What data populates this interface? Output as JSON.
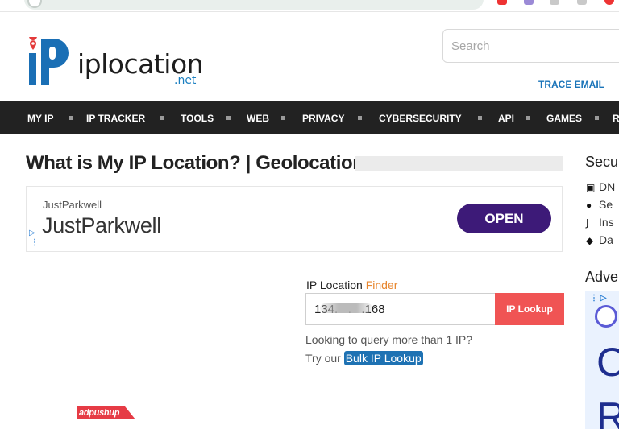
{
  "header": {
    "logo_text": "iplocation",
    "logo_suffix": ".net",
    "search_placeholder": "Search",
    "trace_email": "TRACE EMAIL"
  },
  "nav": {
    "items": [
      "MY IP",
      "IP TRACKER",
      "TOOLS",
      "WEB",
      "PRIVACY",
      "CYBERSECURITY",
      "API",
      "GAMES",
      "R"
    ]
  },
  "main": {
    "title": "What is My IP Location? | Geolocation",
    "ad": {
      "small_label": "JustParkwell",
      "big_label": "JustParkwell",
      "cta": "OPEN"
    },
    "finder": {
      "label_prefix": "IP Location",
      "label_accent": "Finder",
      "ip_value": "134.   .   .168",
      "button": "IP Lookup"
    },
    "query_text": "Looking to query more than 1 IP?",
    "try_text": "Try our",
    "bulk_link": "Bulk IP Lookup",
    "adpushup": "adpushup"
  },
  "sidebar": {
    "heading_security": "Secu",
    "items": [
      "DN",
      "Se",
      "Ins",
      "Da"
    ],
    "heading_ads": "Adve",
    "ad_letters": [
      "C",
      "R"
    ]
  },
  "colors": {
    "nav_bg": "#222222",
    "accent_orange": "#e8862e",
    "lookup_red": "#f05454",
    "link_blue": "#1e72b3",
    "ad_purple": "#3d1a78"
  }
}
